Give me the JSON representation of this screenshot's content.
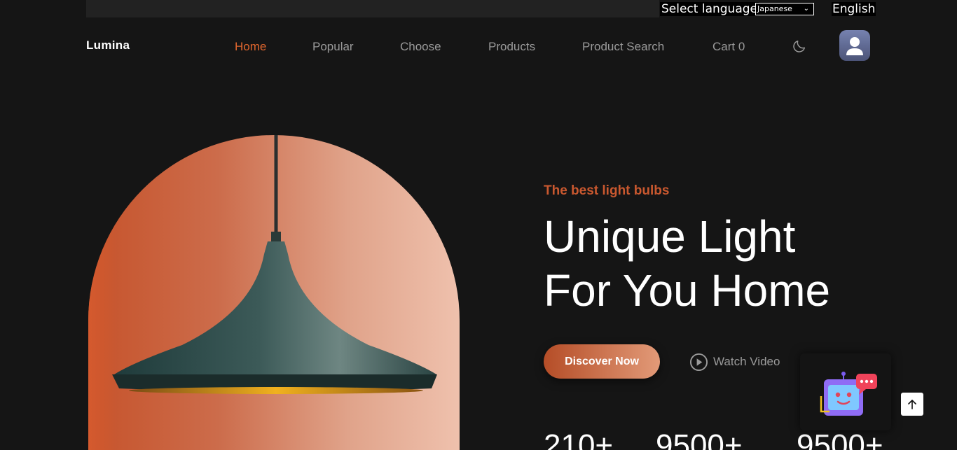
{
  "language": {
    "label": "Select language",
    "selected_option": "Japanese",
    "current_language": "English"
  },
  "header": {
    "logo": "Lumina",
    "nav": [
      {
        "label": "Home",
        "active": true
      },
      {
        "label": "Popular",
        "active": false
      },
      {
        "label": "Choose",
        "active": false
      },
      {
        "label": "Products",
        "active": false
      },
      {
        "label": "Product Search",
        "active": false
      },
      {
        "label": "Cart 0",
        "active": false
      }
    ],
    "theme_icon": "moon-icon",
    "avatar_icon": "user-icon"
  },
  "hero": {
    "subtitle": "The best light bulbs",
    "title_line1": "Unique Light",
    "title_line2": "For You Home",
    "discover_label": "Discover Now",
    "watch_label": "Watch Video",
    "stats": [
      "210+",
      "9500+",
      "9500+"
    ]
  },
  "widgets": {
    "chatbot_icon": "robot-chat-icon",
    "scroll_top_icon": "arrow-up-icon"
  },
  "colors": {
    "accent": "#e0662e",
    "background": "#151515",
    "button_gradient_start": "#b54d27",
    "button_gradient_end": "#e29a78"
  }
}
